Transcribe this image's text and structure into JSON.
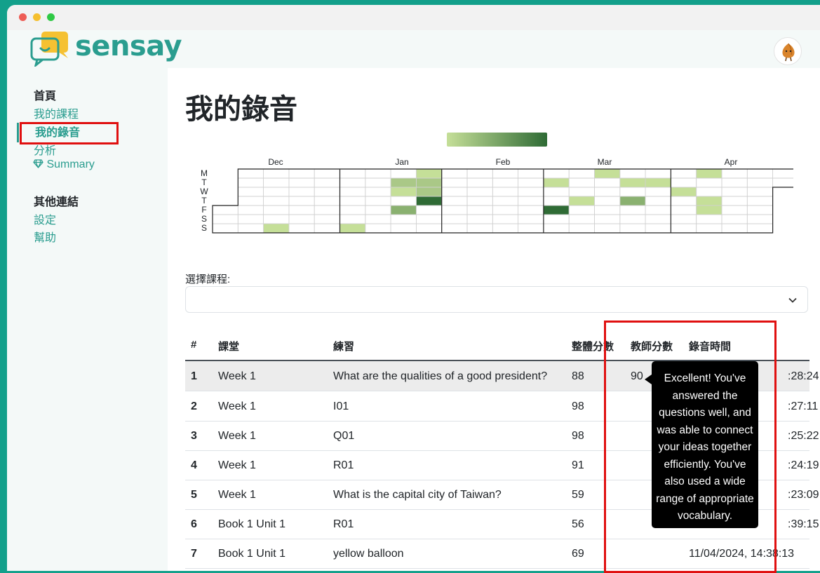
{
  "app": {
    "brand": "sensay",
    "brand_color": "#2a9d8f"
  },
  "sidebar": {
    "section1_heading": "首頁",
    "items": [
      {
        "label": "我的課程"
      },
      {
        "label": "我的錄音",
        "active": true
      },
      {
        "label": "分析"
      },
      {
        "label": "Summary",
        "icon": "diamond-icon"
      }
    ],
    "section2_heading": "其他連結",
    "items2": [
      {
        "label": "設定"
      },
      {
        "label": "幫助"
      }
    ]
  },
  "page": {
    "title": "我的錄音"
  },
  "heatmap": {
    "months": [
      "Dec",
      "Jan",
      "Feb",
      "Mar",
      "Apr"
    ],
    "day_labels": [
      "M",
      "T",
      "W",
      "T",
      "F",
      "S",
      "S"
    ],
    "legend_colors": [
      "#c5df98",
      "#2f6b35"
    ]
  },
  "filter": {
    "label": "選擇課程:",
    "value": ""
  },
  "table": {
    "headers": [
      "#",
      "課堂",
      "練習",
      "整體分數",
      "教師分數",
      "錄音時間"
    ],
    "rows": [
      {
        "num": "1",
        "lesson": "Week 1",
        "exercise": "What are the qualities of a good president?",
        "overall": "88",
        "teacher": "90",
        "time": ":28:24"
      },
      {
        "num": "2",
        "lesson": "Week 1",
        "exercise": "I01",
        "overall": "98",
        "teacher": "",
        "time": ":27:11"
      },
      {
        "num": "3",
        "lesson": "Week 1",
        "exercise": "Q01",
        "overall": "98",
        "teacher": "",
        "time": ":25:22"
      },
      {
        "num": "4",
        "lesson": "Week 1",
        "exercise": "R01",
        "overall": "91",
        "teacher": "",
        "time": ":24:19"
      },
      {
        "num": "5",
        "lesson": "Week 1",
        "exercise": "What is the capital city of Taiwan?",
        "overall": "59",
        "teacher": "",
        "time": ":23:09"
      },
      {
        "num": "6",
        "lesson": "Book 1 Unit 1",
        "exercise": "R01",
        "overall": "56",
        "teacher": "",
        "time": ":39:15"
      },
      {
        "num": "7",
        "lesson": "Book 1 Unit 1",
        "exercise": "yellow balloon",
        "overall": "69",
        "teacher": "",
        "time": "11/04/2024, 14:38:13"
      }
    ]
  },
  "tooltip": {
    "lines": [
      "Excellent! You've",
      "answered the",
      "questions well, and",
      "was able to connect",
      "your ideas together",
      "efficiently. You've",
      "also used a wide",
      "range of appropriate",
      "vocabulary."
    ]
  }
}
